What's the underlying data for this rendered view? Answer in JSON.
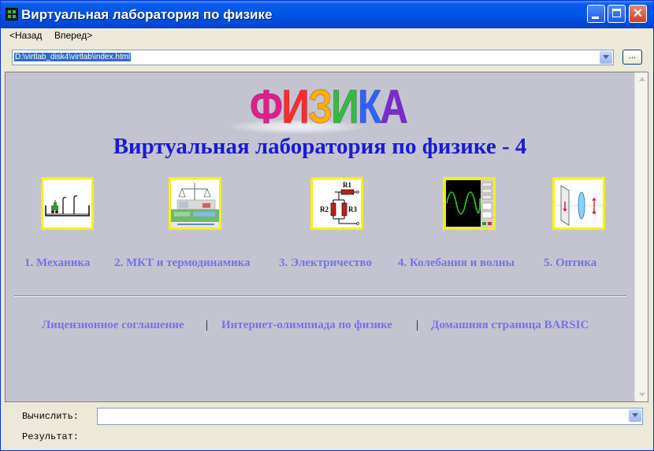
{
  "window": {
    "title": "Виртуальная лаборатория по физике",
    "minimize_label": "",
    "maximize_label": "",
    "close_label": "✕"
  },
  "nav": {
    "back": "<Назад",
    "forward": "Вперед>"
  },
  "address": {
    "value": "D:\\virtlab_disk4\\virtlab\\index.html",
    "browse_label": "..."
  },
  "page": {
    "logo_letters": [
      "Ф",
      "И",
      "З",
      "И",
      "К",
      "А"
    ],
    "logo_colors": [
      "#e01e8c",
      "#ff2a2a",
      "#ffb000",
      "#2fbf3a",
      "#2c64ff",
      "#7a2bd0"
    ],
    "title": "Виртуальная лаборатория по физике - 4",
    "thumbnails": [
      {
        "icon": "mechanics-icon"
      },
      {
        "icon": "thermodynamics-icon"
      },
      {
        "icon": "electric-circuit-icon"
      },
      {
        "icon": "oscilloscope-icon"
      },
      {
        "icon": "optics-lens-icon"
      }
    ],
    "circuit_labels": [
      "R1",
      "R2",
      "R3"
    ],
    "sections": [
      "1. Механика",
      "2. МКТ и термодинамика",
      "3. Электричество",
      "4. Колебания и волны",
      "5. Оптика"
    ],
    "footer_links": [
      "Лицензионное соглашение",
      "Интернет-олимпиада по физике",
      "Домашняя страница BARSIC"
    ],
    "separator": "|"
  },
  "bottom": {
    "calc_label": "Вычислить:",
    "calc_value": "",
    "result_label": "Результат:"
  },
  "colors": {
    "content_bg": "#c4c4d1",
    "title_color": "#1a1ad6",
    "link_color": "#7373e8",
    "thumb_border": "#f6f205"
  }
}
